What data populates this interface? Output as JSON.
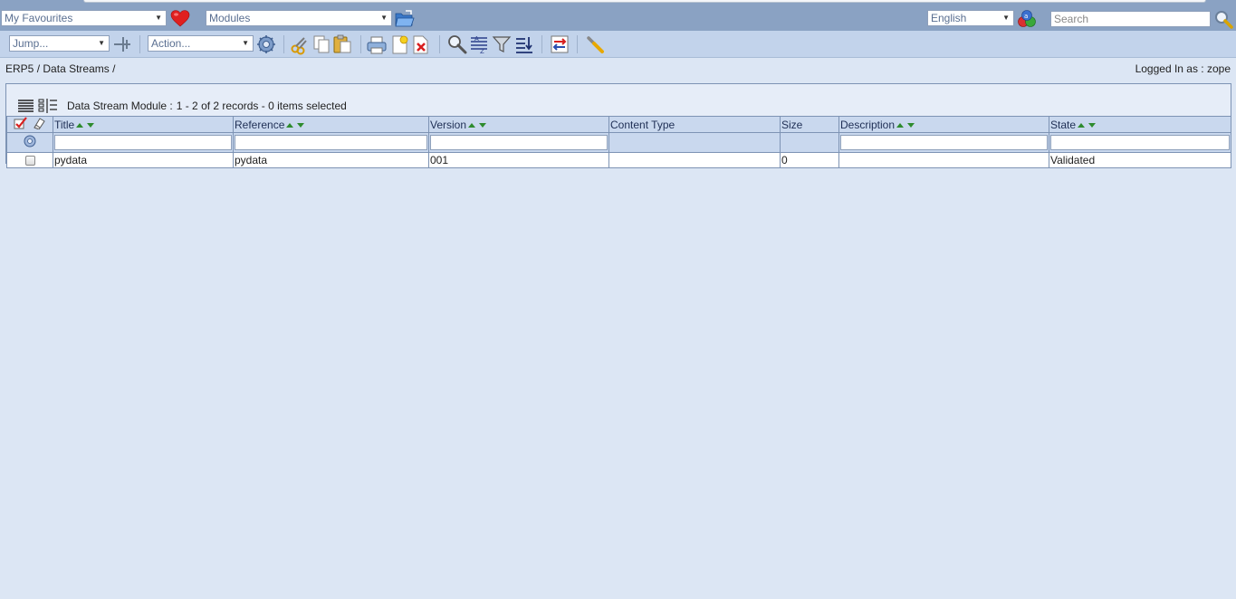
{
  "topbar": {
    "favourites_select": "My Favourites",
    "modules_select": "Modules",
    "language_select": "English",
    "search_placeholder": "Search"
  },
  "toolbar": {
    "jump_select": "Jump...",
    "action_select": "Action..."
  },
  "breadcrumb": {
    "root": "ERP5",
    "separator": "/",
    "current": "Data Streams",
    "trailing": "/"
  },
  "user": {
    "logged_in": "Logged In as : zope"
  },
  "listbox": {
    "title": "Data Stream Module :",
    "summary": "1 - 2 of 2 records - 0 items selected",
    "columns": [
      {
        "label": "Title",
        "sortable": true
      },
      {
        "label": "Reference",
        "sortable": true
      },
      {
        "label": "Version",
        "sortable": true
      },
      {
        "label": "Content Type",
        "sortable": false
      },
      {
        "label": "Size",
        "sortable": false
      },
      {
        "label": "Description",
        "sortable": true
      },
      {
        "label": "State",
        "sortable": true
      }
    ],
    "rows": [
      {
        "title": "pydata",
        "reference": "pydata",
        "version": "001",
        "content_type": "",
        "size": "0",
        "description": "",
        "state": "Validated"
      }
    ]
  },
  "colors": {
    "page_bg": "#dce6f4",
    "top_bar": "#8aa2c3",
    "toolbar": "#c2d3eb",
    "header_cell": "#c9d8ee",
    "sort_arrow": "#2e8b2e"
  }
}
